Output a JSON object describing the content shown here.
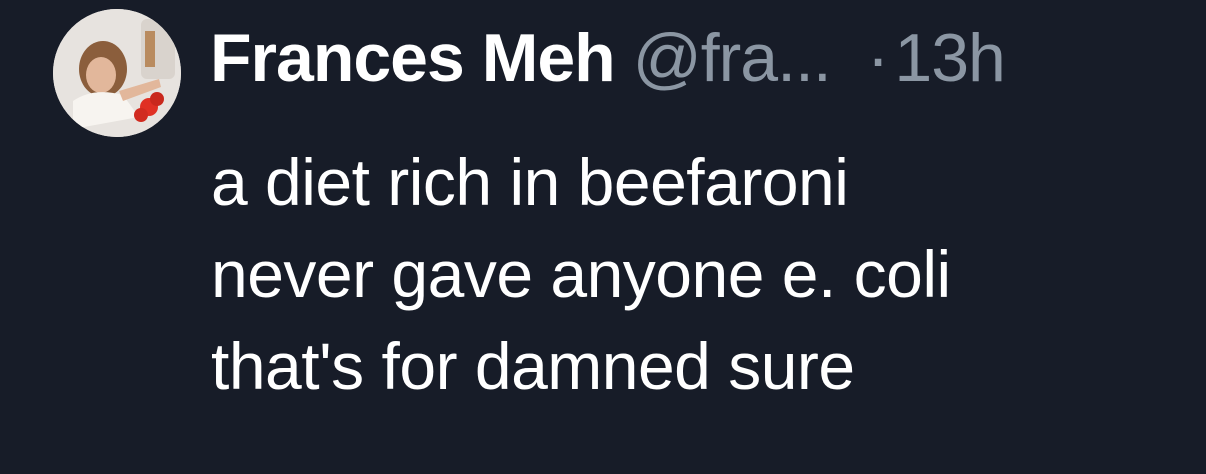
{
  "tweet": {
    "author": {
      "display_name": "Frances Meh",
      "handle": "@fra..."
    },
    "separator": "·",
    "timestamp": "13h",
    "text_lines": [
      "a diet rich in beefaroni",
      "never gave anyone e. coli",
      "that's for damned sure"
    ]
  },
  "colors": {
    "background": "#171c28",
    "primary_text": "#ffffff",
    "secondary_text": "#8b96a3"
  }
}
